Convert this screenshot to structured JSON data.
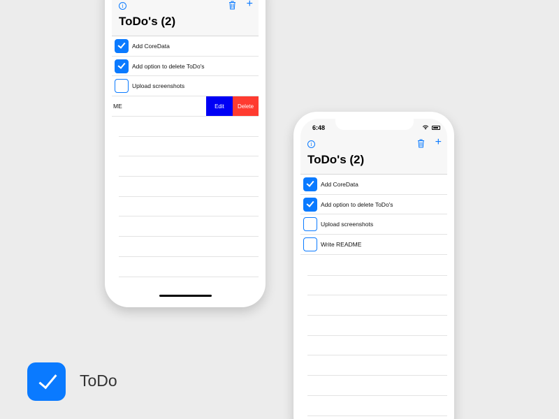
{
  "app": {
    "name": "ToDo",
    "accent_color": "#0a7aff",
    "icon": "checkmark-icon"
  },
  "status_bar": {
    "time": "6:48"
  },
  "nav": {
    "title": "ToDo's (2)",
    "info_icon": "info-icon",
    "trash_icon": "trash-icon",
    "add_label": "+"
  },
  "left_phone": {
    "todos": [
      {
        "label": "Add CoreData",
        "done": true
      },
      {
        "label": "Add option to delete ToDo's",
        "done": true
      },
      {
        "label": "Upload screenshots",
        "done": false
      }
    ],
    "swiped_row": {
      "visible_label": "ME",
      "edit_label": "Edit",
      "delete_label": "Delete",
      "edit_color": "#0000f5",
      "delete_color": "#ff3b30"
    }
  },
  "right_phone": {
    "todos": [
      {
        "label": "Add CoreData",
        "done": true
      },
      {
        "label": "Add option to delete ToDo's",
        "done": true
      },
      {
        "label": "Upload screenshots",
        "done": false
      },
      {
        "label": "Write README",
        "done": false
      }
    ]
  }
}
